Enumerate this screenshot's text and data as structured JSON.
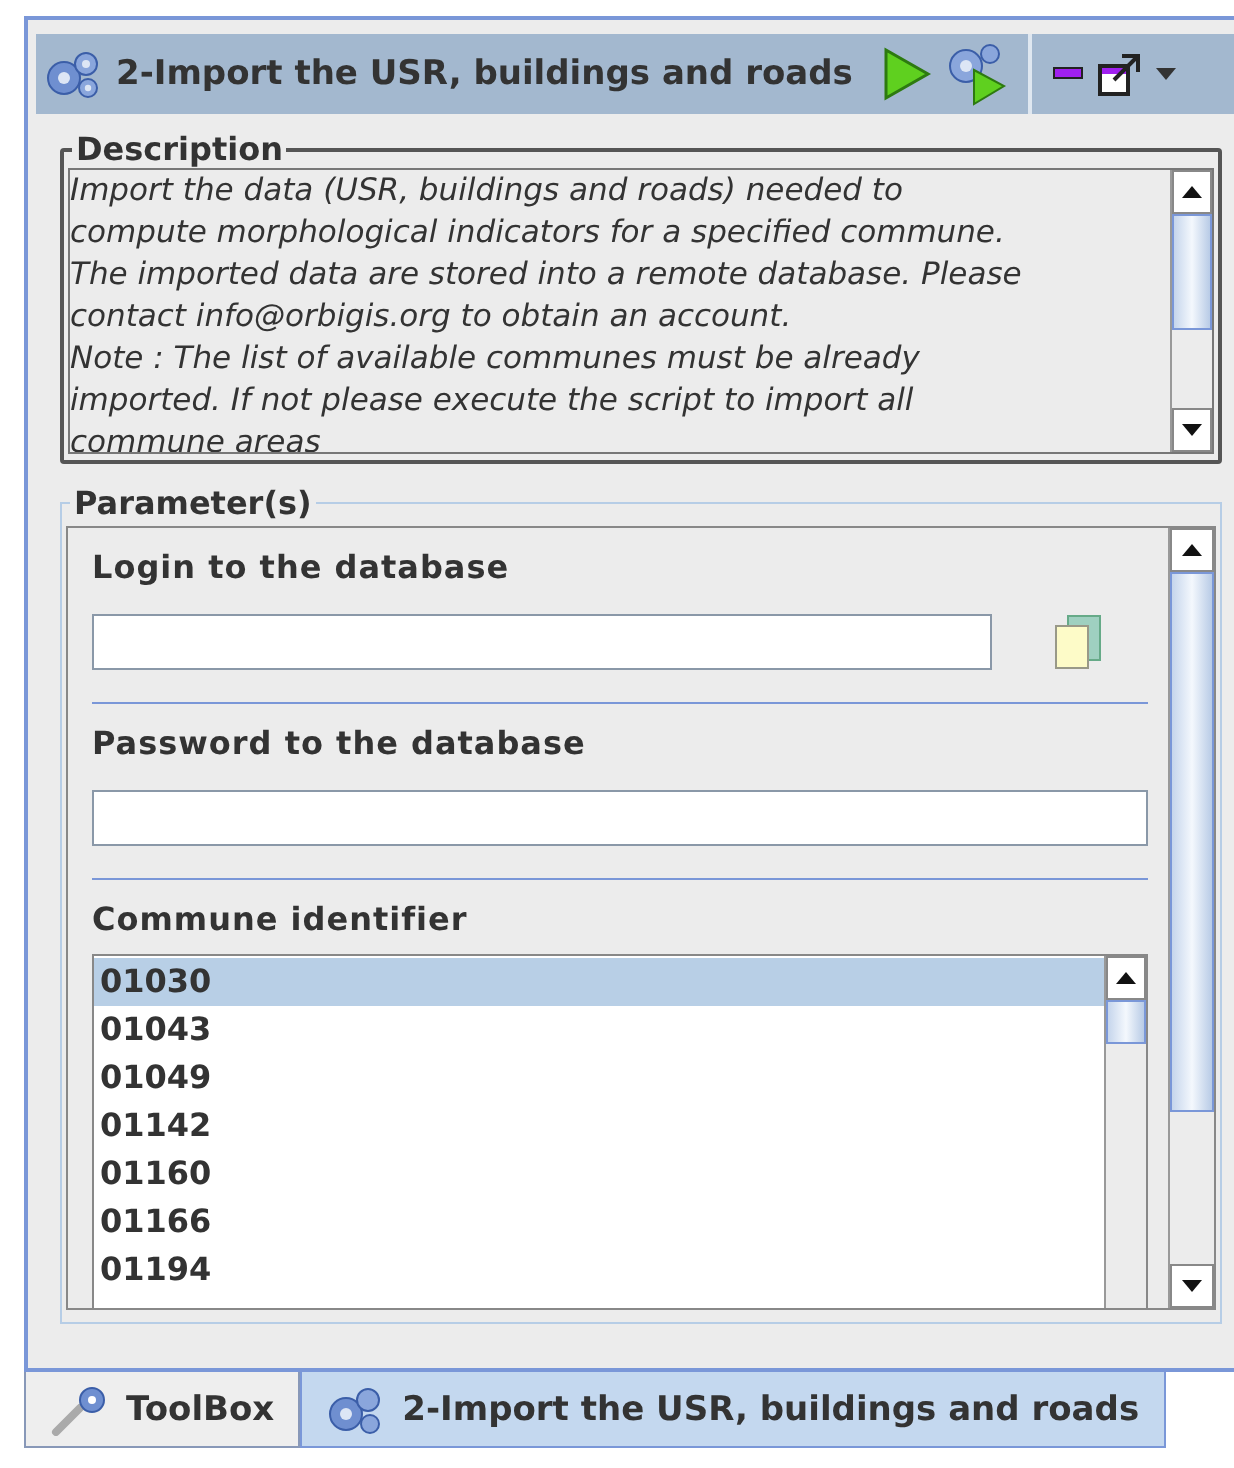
{
  "panel": {
    "title": "2-Import the USR, buildings and roads"
  },
  "description": {
    "legend": "Description",
    "lines": [
      "Import the data (USR, buildings and roads) needed to",
      "compute morphological indicators for a specified commune.",
      "The imported data are stored into a remote database. Please",
      "contact info@orbigis.org to obtain an account.",
      "Note : The list of available communes must be already",
      "imported. If not please execute the script to import all",
      "commune areas"
    ]
  },
  "parameters": {
    "legend": "Parameter(s)",
    "fields": [
      {
        "kind": "text",
        "label": "Login to the database"
      },
      {
        "kind": "password",
        "label": "Password to the database"
      },
      {
        "kind": "list",
        "label": "Commune identifier",
        "items": [
          {
            "text": "01030",
            "selected": true
          },
          {
            "text": "01043",
            "selected": false
          },
          {
            "text": "01049",
            "selected": false
          },
          {
            "text": "01142",
            "selected": false
          },
          {
            "text": "01160",
            "selected": false
          },
          {
            "text": "01166",
            "selected": false
          },
          {
            "text": "01194",
            "selected": false
          }
        ]
      }
    ]
  },
  "tabs": [
    {
      "label": "ToolBox",
      "selected": false
    },
    {
      "label": "2-Import the USR, buildings and roads",
      "selected": true
    }
  ]
}
